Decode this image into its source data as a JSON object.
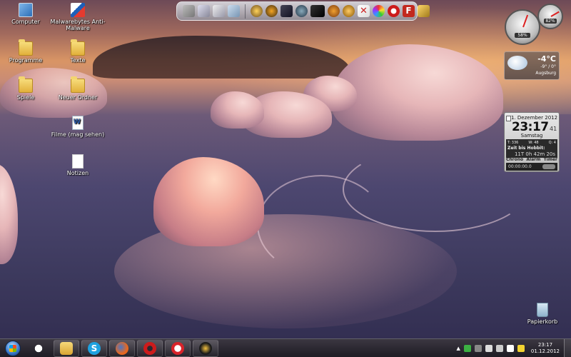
{
  "desktop": {
    "icons": [
      {
        "label": "Computer"
      },
      {
        "label": "Malwarebytes Anti-Malware"
      },
      {
        "label": "Programme"
      },
      {
        "label": "Texte"
      },
      {
        "label": "Spiele"
      },
      {
        "label": "Neuer Ordner"
      },
      {
        "label": "Filme (mag sehen)"
      },
      {
        "label": "Notizen"
      },
      {
        "label": "Papierkorb"
      }
    ]
  },
  "gadgets": {
    "meter": {
      "cpu_percent": "58%",
      "memory_percent": "82%"
    },
    "weather": {
      "temp": "-4°C",
      "range": "-9° / 0°",
      "city": "Augsburg"
    },
    "clock": {
      "date": "1. Dezember 2012",
      "time": "23:17",
      "seconds": "41",
      "day": "Samstag",
      "stats": [
        "T: 336",
        "W: 48",
        "Q: 4"
      ],
      "countdown_label": "Zeit bis Hobbit:",
      "countdown_value": "11T 0h 42m 20s",
      "tabs": [
        "Chrono",
        "Alarm",
        "Timer"
      ],
      "timer_value": "00:00:00.0"
    }
  },
  "taskbar": {
    "clock_time": "23:17",
    "clock_date": "01.12.2012"
  },
  "colors": {
    "opera_red": "#cc1b1b",
    "skype_blue": "#1ea2e0",
    "firefox_orange": "#e8681e"
  }
}
